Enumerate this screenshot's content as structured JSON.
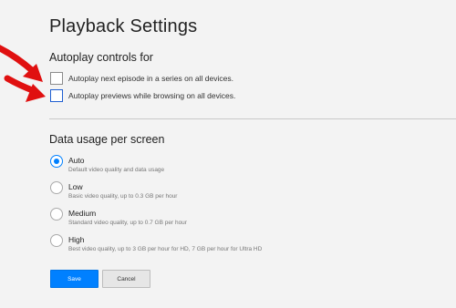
{
  "page": {
    "title": "Playback Settings"
  },
  "autoplay": {
    "title": "Autoplay controls for",
    "options": [
      {
        "label": "Autoplay next episode in a series on all devices.",
        "checked": false
      },
      {
        "label": "Autoplay previews while browsing on all devices.",
        "checked": false
      }
    ]
  },
  "data_usage": {
    "title": "Data usage per screen",
    "selected": "Auto",
    "options": [
      {
        "label": "Auto",
        "description": "Default video quality and data usage"
      },
      {
        "label": "Low",
        "description": "Basic video quality, up to 0.3 GB per hour"
      },
      {
        "label": "Medium",
        "description": "Standard video quality, up to 0.7 GB per hour"
      },
      {
        "label": "High",
        "description": "Best video quality, up to 3 GB per hour for HD, 7 GB per hour for Ultra HD"
      }
    ]
  },
  "buttons": {
    "save_label": "Save",
    "cancel_label": "Cancel"
  },
  "colors": {
    "accent": "#0080ff",
    "annotation_arrow": "#e01010",
    "background": "#f3f3f3"
  }
}
